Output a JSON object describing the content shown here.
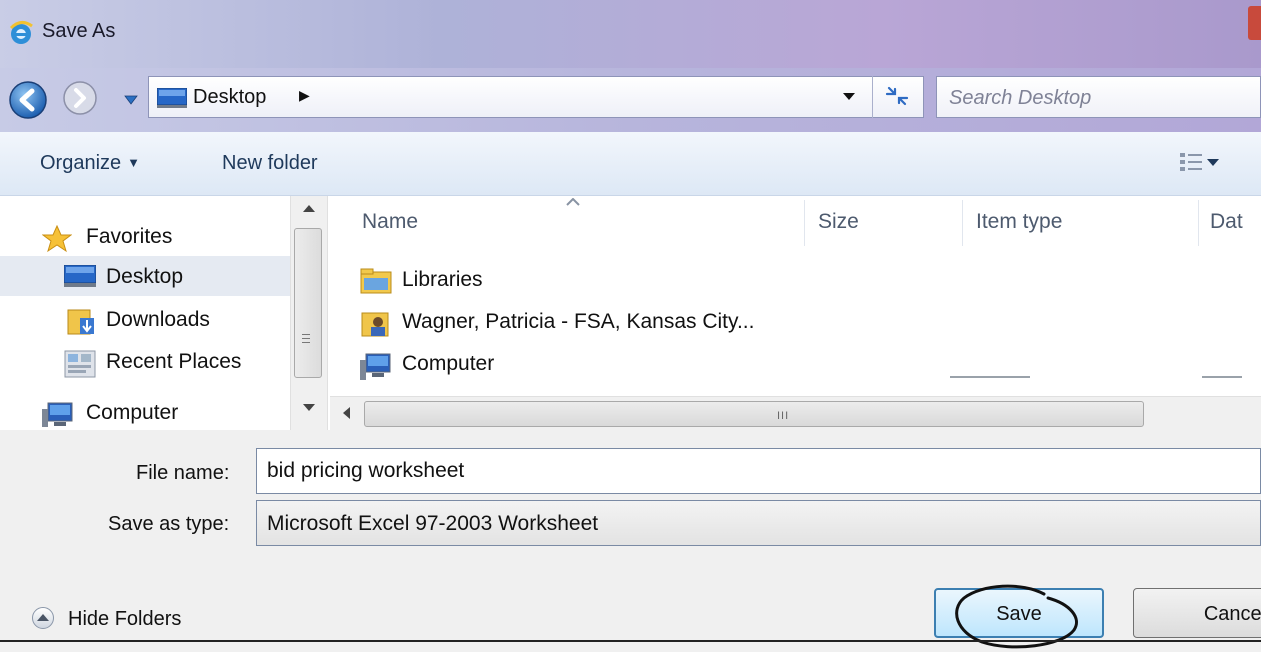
{
  "window": {
    "title": "Save As"
  },
  "address_bar": {
    "location": "Desktop",
    "chevron": "▶"
  },
  "search": {
    "placeholder": "Search Desktop"
  },
  "toolbar": {
    "organize_label": "Organize",
    "new_folder_label": "New folder"
  },
  "nav_pane": {
    "items": [
      {
        "label": "Favorites",
        "icon": "star-icon",
        "selected": false
      },
      {
        "label": "Desktop",
        "icon": "desktop-icon",
        "selected": true
      },
      {
        "label": "Downloads",
        "icon": "downloads-icon",
        "selected": false
      },
      {
        "label": "Recent Places",
        "icon": "recent-places-icon",
        "selected": false
      },
      {
        "label": "Computer",
        "icon": "computer-icon",
        "selected": false
      }
    ]
  },
  "file_list": {
    "columns": [
      "Name",
      "Size",
      "Item type",
      "Dat"
    ],
    "rows": [
      {
        "name": "Libraries",
        "icon": "libraries-icon"
      },
      {
        "name": "Wagner, Patricia - FSA, Kansas City...",
        "icon": "user-folder-icon"
      },
      {
        "name": "Computer",
        "icon": "computer-icon"
      }
    ],
    "hscroll_grip": "III"
  },
  "form": {
    "file_name_label": "File name:",
    "file_name_value": "bid pricing worksheet",
    "save_type_label": "Save as type:",
    "save_type_value": "Microsoft Excel 97-2003 Worksheet"
  },
  "footer": {
    "hide_folders_label": "Hide Folders",
    "save_label": "Save",
    "cancel_label": "Cancel"
  },
  "colors": {
    "title_gradient_start": "#c9cde6",
    "title_gradient_end": "#a999cc",
    "toolbar_text": "#1e395b",
    "selected_item_bg": "#e5eaf2",
    "save_button_border": "#3c7fb1",
    "form_bg": "#f0f0f0"
  }
}
